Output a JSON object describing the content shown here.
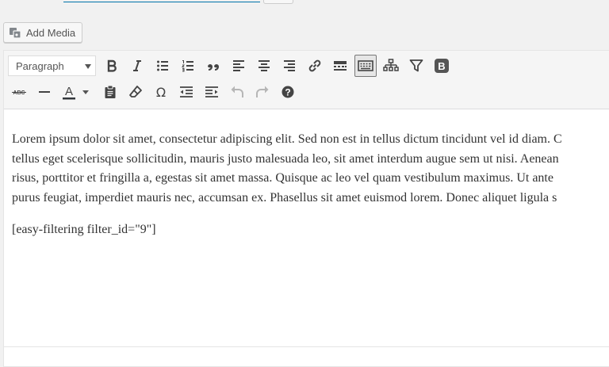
{
  "media": {
    "add_media_label": "Add Media"
  },
  "toolbar": {
    "format_select_value": "Paragraph",
    "row1_buttons": [
      "bold",
      "italic",
      "bulleted-list",
      "numbered-list",
      "blockquote",
      "align-left",
      "align-center",
      "align-right",
      "insert-link",
      "read-more",
      "toolbar-toggle",
      "sitemap",
      "easy-filtering",
      "bootstrap"
    ],
    "row2_buttons": [
      "strikethrough",
      "horizontal-line",
      "text-color",
      "paste-as-text",
      "clear-formatting",
      "special-character",
      "outdent",
      "indent",
      "undo",
      "redo",
      "keyboard-shortcuts"
    ],
    "bootstrap_label": "B",
    "text_color_label": "A",
    "strike_label": "ABC",
    "special_char_label": "Ω",
    "help_label": "?"
  },
  "content": {
    "lines": [
      "Lorem ipsum dolor sit amet, consectetur adipiscing elit. Sed non est in tellus dictum tincidunt vel id diam. C",
      "tellus eget scelerisque sollicitudin, mauris justo malesuada leo, sit amet interdum augue sem ut nisi. Aenean",
      "risus, porttitor et fringilla a, egestas sit amet massa. Quisque ac leo vel quam vestibulum maximus. Ut ante",
      "purus feugiat, imperdiet mauris nec, accumsan ex. Phasellus sit amet euismod lorem. Donec aliquet ligula s"
    ],
    "shortcode": "[easy-filtering filter_id=\"9\"]"
  },
  "colors": {
    "text_color_bar": "#32373c",
    "bootstrap_bg": "#555555",
    "link_blue": "#0073aa"
  }
}
